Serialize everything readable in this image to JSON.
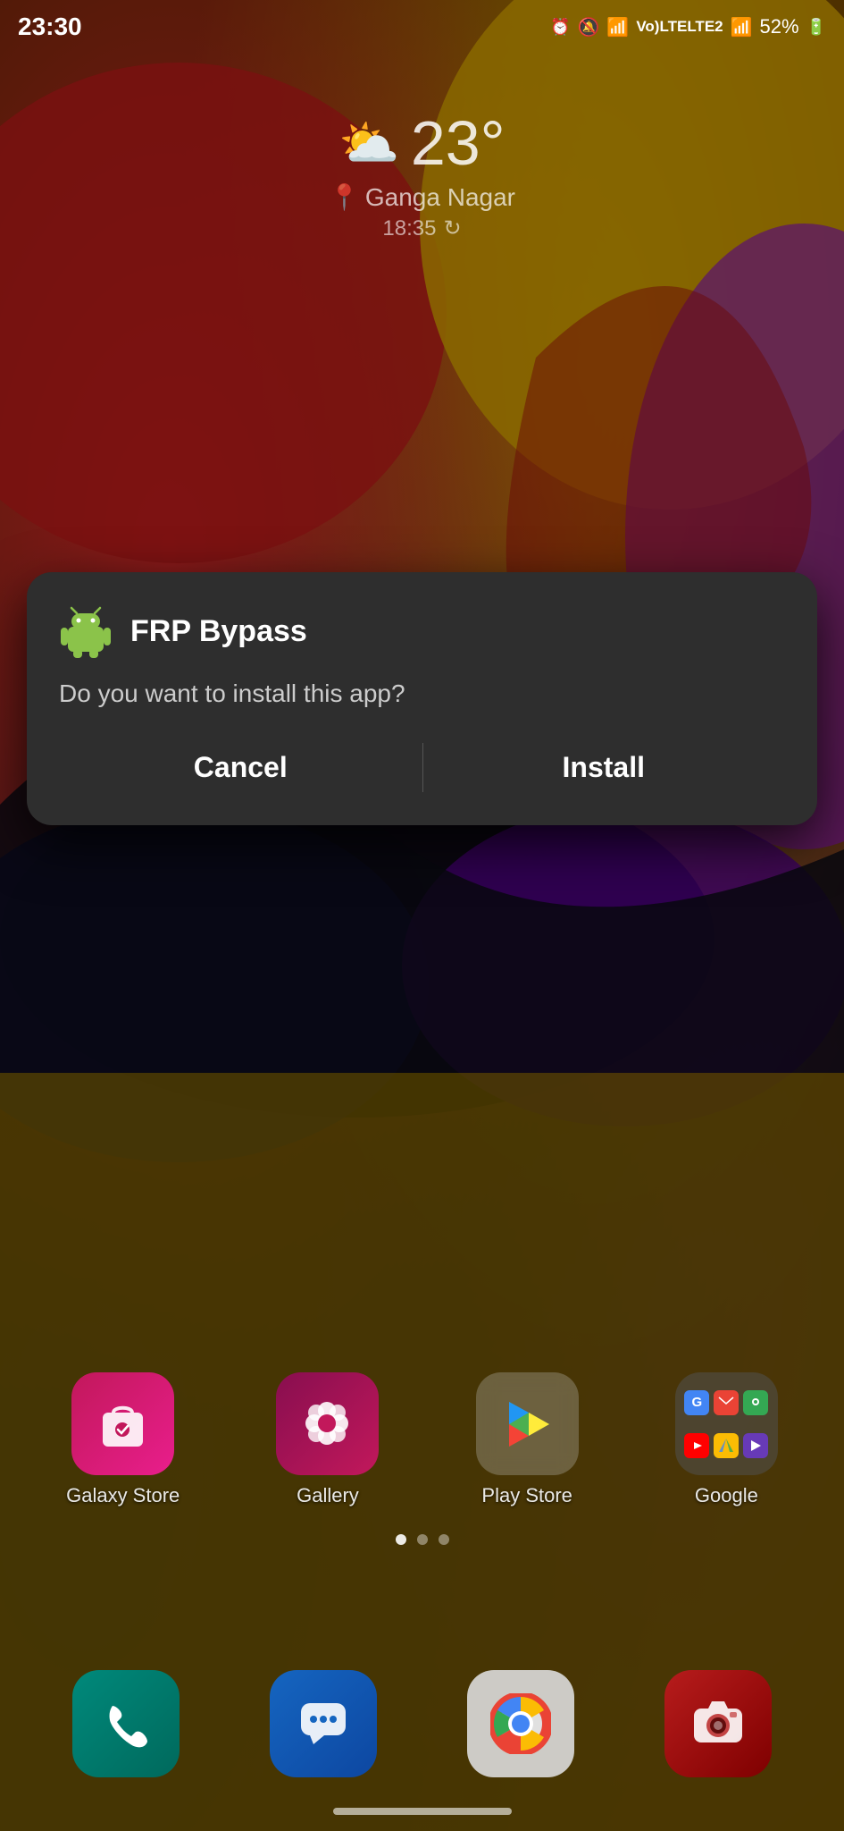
{
  "statusBar": {
    "time": "23:30",
    "battery": "52%",
    "batteryIcon": "🔋",
    "alarmIcon": "⏰",
    "muteIcon": "🔇",
    "signalText": "Vo) LTE LTE2",
    "networkBars": "📶"
  },
  "weather": {
    "temperature": "23°",
    "icon": "⛅",
    "location": "Ganga Nagar",
    "locationIcon": "📍",
    "time": "18:35",
    "refreshIcon": "↻"
  },
  "dialog": {
    "appName": "FRP Bypass",
    "question": "Do you want to install this app?",
    "cancelLabel": "Cancel",
    "installLabel": "Install"
  },
  "apps": [
    {
      "name": "Galaxy Store",
      "type": "galaxy-store"
    },
    {
      "name": "Gallery",
      "type": "gallery"
    },
    {
      "name": "Play Store",
      "type": "play-store"
    },
    {
      "name": "Google",
      "type": "google-folder"
    }
  ],
  "pageIndicators": [
    {
      "active": true
    },
    {
      "active": false
    },
    {
      "active": false
    }
  ],
  "dock": [
    {
      "name": "Phone",
      "type": "phone"
    },
    {
      "name": "Messages",
      "type": "messages"
    },
    {
      "name": "Chrome",
      "type": "chrome"
    },
    {
      "name": "Camera",
      "type": "camera"
    }
  ],
  "colors": {
    "dialogBg": "#2e2e2e",
    "accent": "#ffffff"
  }
}
